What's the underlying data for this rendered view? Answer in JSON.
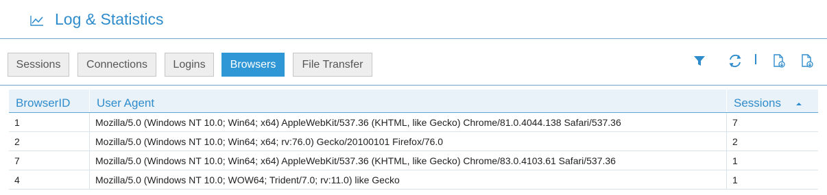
{
  "header": {
    "icon": "line-chart-icon",
    "title": "Log & Statistics"
  },
  "tabs": [
    {
      "label": "Sessions",
      "active": false
    },
    {
      "label": "Connections",
      "active": false
    },
    {
      "label": "Logins",
      "active": false
    },
    {
      "label": "Browsers",
      "active": true
    },
    {
      "label": "File Transfer",
      "active": false
    }
  ],
  "toolbar": {
    "icons": [
      "filter-icon",
      "refresh-icon",
      "export-file-icon",
      "download-file-icon"
    ]
  },
  "table": {
    "columns": [
      "BrowserID",
      "User Agent",
      "Sessions"
    ],
    "sort": {
      "column": "Sessions",
      "direction": "ascending"
    },
    "rows": [
      [
        "1",
        "Mozilla/5.0 (Windows NT 10.0; Win64; x64) AppleWebKit/537.36 (KHTML, like Gecko) Chrome/81.0.4044.138 Safari/537.36",
        "7"
      ],
      [
        "2",
        "Mozilla/5.0 (Windows NT 10.0; Win64; x64; rv:76.0) Gecko/20100101 Firefox/76.0",
        "2"
      ],
      [
        "7",
        "Mozilla/5.0 (Windows NT 10.0; Win64; x64) AppleWebKit/537.36 (KHTML, like Gecko) Chrome/83.0.4103.61 Safari/537.36",
        "1"
      ],
      [
        "4",
        "Mozilla/5.0 (Windows NT 10.0; WOW64; Trident/7.0; rv:11.0) like Gecko",
        "1"
      ]
    ]
  },
  "colors": {
    "accent": "#2f8ccc",
    "active_tab": "#2f97d6",
    "header_bg": "#e9f2f8"
  }
}
